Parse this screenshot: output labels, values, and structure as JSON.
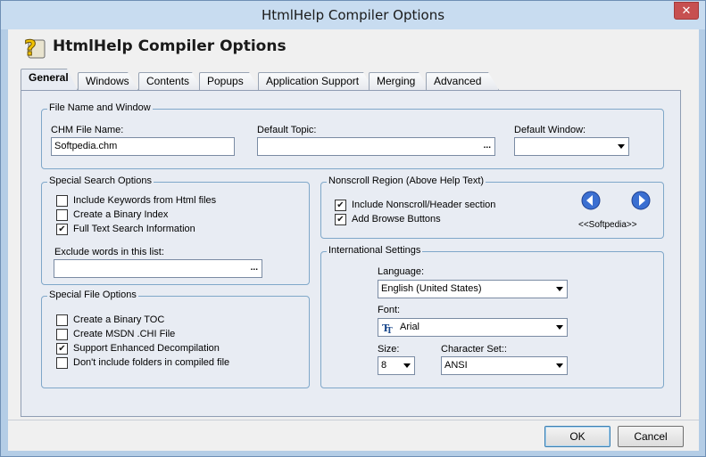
{
  "window": {
    "title": "HtmlHelp Compiler Options",
    "close_label": "✕"
  },
  "header": {
    "title": "HtmlHelp Compiler Options"
  },
  "tabs": [
    {
      "label": "General",
      "active": true
    },
    {
      "label": "Windows"
    },
    {
      "label": "Contents"
    },
    {
      "label": "Popups"
    },
    {
      "label": "Application Support"
    },
    {
      "label": "Merging"
    },
    {
      "label": "Advanced"
    }
  ],
  "file_name_window": {
    "group_label": "File Name and Window",
    "chm_label": "CHM File Name:",
    "chm_value": "Softpedia.chm",
    "topic_label": "Default Topic:",
    "topic_value": "",
    "topic_button": "...",
    "window_label": "Default Window:",
    "window_value": ""
  },
  "special_search": {
    "group_label": "Special Search Options",
    "options": [
      {
        "label": "Include Keywords from Html files",
        "checked": false
      },
      {
        "label": "Create a Binary Index",
        "checked": false
      },
      {
        "label": "Full Text Search Information",
        "checked": true
      }
    ],
    "exclude_label": "Exclude words in this list:",
    "exclude_value": "",
    "exclude_button": "..."
  },
  "nonscroll": {
    "group_label": "Nonscroll Region (Above Help Text)",
    "options": [
      {
        "label": "Include Nonscroll/Header section",
        "checked": true
      },
      {
        "label": "Add Browse Buttons",
        "checked": true
      }
    ],
    "browse_caption": "<<Softpedia>>"
  },
  "special_file": {
    "group_label": "Special File Options",
    "options": [
      {
        "label": "Create a Binary TOC",
        "checked": false
      },
      {
        "label": "Create MSDN .CHI File",
        "checked": false
      },
      {
        "label": "Support Enhanced Decompilation",
        "checked": true
      },
      {
        "label": "Don't include folders in compiled file",
        "checked": false
      }
    ]
  },
  "international": {
    "group_label": "International Settings",
    "language_label": "Language:",
    "language_value": "English (United States)",
    "font_label": "Font:",
    "font_value": "Arial",
    "size_label": "Size:",
    "size_value": "8",
    "charset_label": "Character Set::",
    "charset_value": "ANSI"
  },
  "buttons": {
    "ok": "OK",
    "cancel": "Cancel"
  },
  "icons": {
    "help_icon": "question-mark-icon",
    "font_icon": "truetype-icon",
    "check": "✔"
  }
}
